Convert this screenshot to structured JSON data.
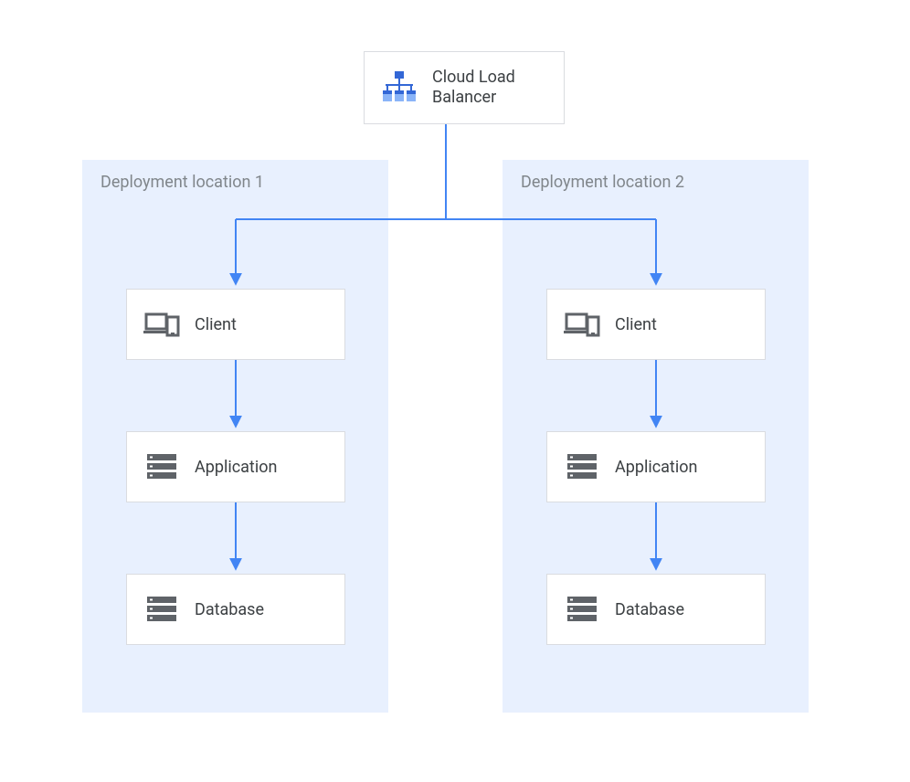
{
  "diagram": {
    "top": {
      "load_balancer_label": "Cloud Load\nBalancer"
    },
    "regions": [
      {
        "title": "Deployment location 1",
        "client_label": "Client",
        "application_label": "Application",
        "database_label": "Database"
      },
      {
        "title": "Deployment location 2",
        "client_label": "Client",
        "application_label": "Application",
        "database_label": "Database"
      }
    ],
    "colors": {
      "region_bg": "#e8f0fe",
      "node_border": "#dadce0",
      "connector": "#4285f4",
      "icon_gray": "#5f6368",
      "icon_blue_dark": "#3367d6",
      "icon_blue_light": "#8ab4f8"
    }
  }
}
